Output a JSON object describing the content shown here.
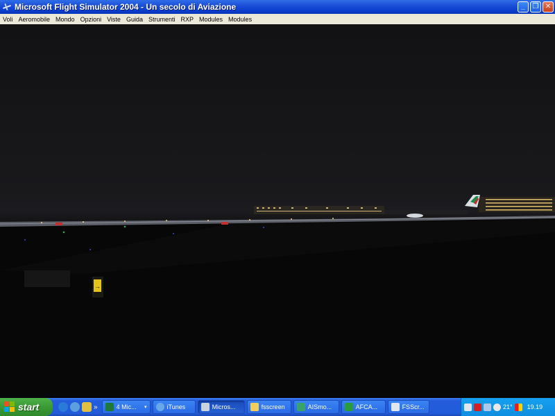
{
  "window": {
    "title": "Microsoft Flight Simulator 2004 - Un secolo di Aviazione",
    "buttons": {
      "minimize": "_",
      "restore": "❐",
      "close": "✕"
    }
  },
  "menu": {
    "items": [
      "Voli",
      "Aeromobile",
      "Mondo",
      "Opzioni",
      "Viste",
      "Guida",
      "Strumenti",
      "RXP",
      "Modules",
      "Modules"
    ]
  },
  "taskbar": {
    "start_label": "start",
    "quicklaunch_more": "»",
    "buttons": [
      {
        "label": "4 Mic...",
        "icon": "excel-icon",
        "color": "#1f7a3a"
      },
      {
        "label": "iTunes",
        "icon": "itunes-icon",
        "color": "#6aa7e8"
      },
      {
        "label": "Micros...",
        "icon": "flight-sim-icon",
        "color": "#c8d3e0"
      },
      {
        "label": "fsscreen",
        "icon": "folder-icon",
        "color": "#f2cf5b"
      },
      {
        "label": "AISmo...",
        "icon": "app-icon",
        "color": "#3aa36a"
      },
      {
        "label": "AFCA...",
        "icon": "plane-icon",
        "color": "#2a9d3a"
      },
      {
        "label": "FSScr...",
        "icon": "window-icon",
        "color": "#dfe6ef"
      }
    ],
    "tray": {
      "temperature": "21°",
      "clock": "19.19"
    }
  }
}
